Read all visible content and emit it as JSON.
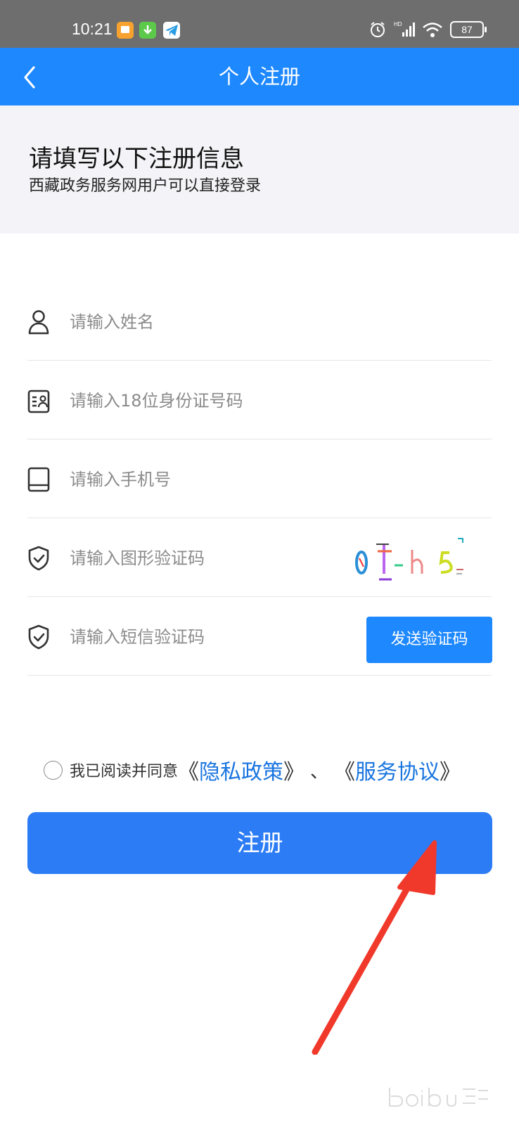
{
  "status_bar": {
    "time": "10:21",
    "battery": "87",
    "icons": [
      "notification-app-icon",
      "download-app-icon",
      "telegram-app-icon",
      "alarm-icon",
      "signal-icon",
      "wifi-icon",
      "battery-icon"
    ]
  },
  "navbar": {
    "title": "个人注册",
    "back_icon": "chevron-left-icon"
  },
  "info": {
    "title": "请填写以下注册信息",
    "subtitle": "西藏政务服务网用户可以直接登录"
  },
  "form": {
    "name_placeholder": "请输入姓名",
    "id_placeholder": "请输入18位身份证号码",
    "phone_placeholder": "请输入手机号",
    "captcha_placeholder": "请输入图形验证码",
    "sms_placeholder": "请输入短信验证码",
    "captcha_text": "0t-h5",
    "send_code_label": "发送验证码"
  },
  "agreement": {
    "text": "我已阅读并同意",
    "open_bracket": "《",
    "close_bracket": "》",
    "privacy_link": "隐私政策",
    "separator": "、",
    "service_link": "服务协议"
  },
  "register_label": "注册",
  "colors": {
    "status_bar": "#6e6e6e",
    "primary": "#1e88ff",
    "button": "#2c7cf6",
    "link": "#1a75e0",
    "header_bg": "#f4f4f8",
    "arrow": "#f0392b"
  }
}
